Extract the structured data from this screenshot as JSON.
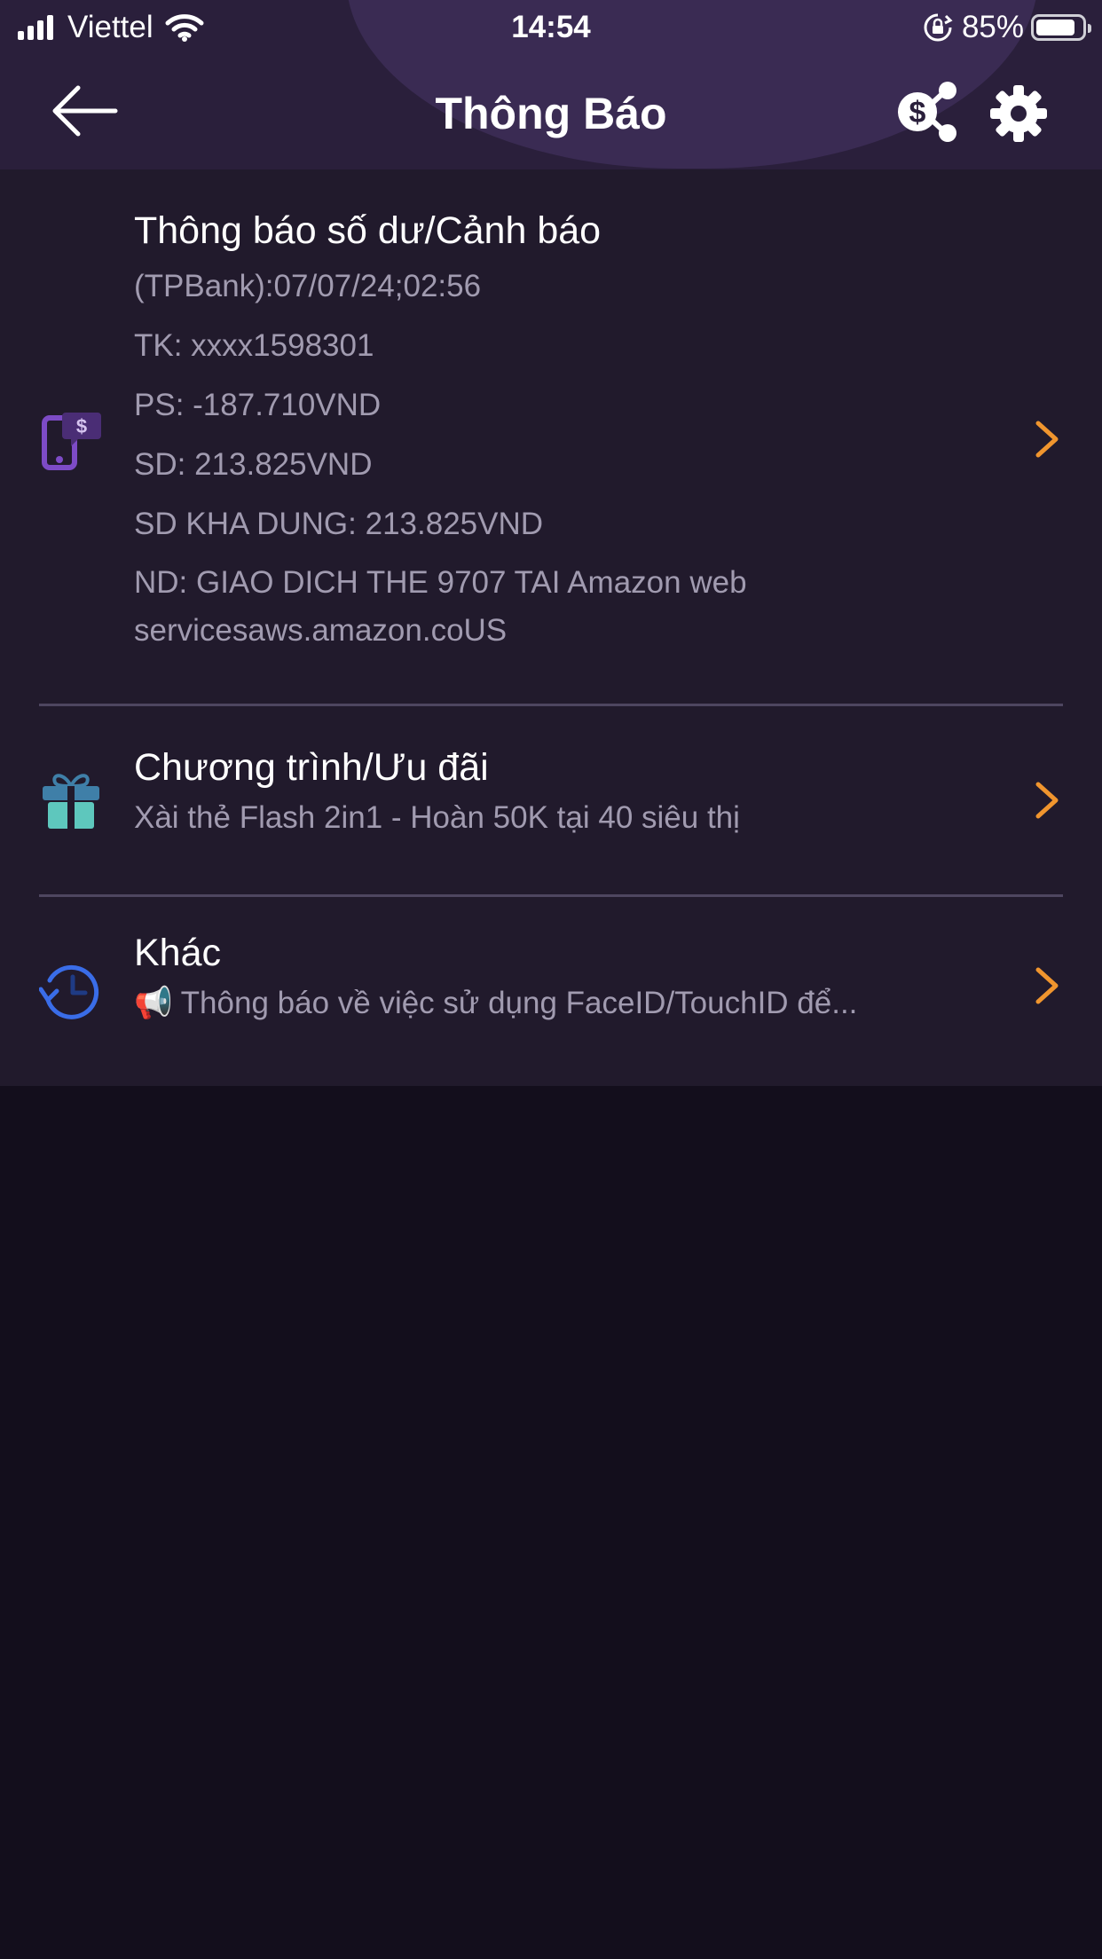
{
  "status_bar": {
    "carrier": "Viettel",
    "time": "14:54",
    "battery_percent": "85%",
    "battery_level": 0.85
  },
  "nav": {
    "title": "Thông Báo",
    "back_icon": "back-arrow-icon",
    "share_icon": "money-share-icon",
    "settings_icon": "gear-icon"
  },
  "items": [
    {
      "title": "Thông báo số dư/Cảnh báo",
      "icon": "phone-dollar-icon",
      "lines": [
        "(TPBank):07/07/24;02:56",
        "TK: xxxx1598301",
        "PS: -187.710VND",
        "SD: 213.825VND",
        "SD KHA DUNG: 213.825VND",
        "ND: GIAO DICH THE 9707 TAI Amazon web servicesaws.amazon.coUS"
      ]
    },
    {
      "title": "Chương trình/Ưu đãi",
      "icon": "gift-icon",
      "subtitle": "Xài thẻ Flash 2in1 - Hoàn 50K tại 40 siêu thị"
    },
    {
      "title": "Khác",
      "icon": "history-clock-icon",
      "subtitle": "📢 Thông báo về việc sử dụng FaceID/TouchID để..."
    }
  ],
  "colors": {
    "header_bg": "#2a1f3b",
    "list_bg": "#211a2c",
    "page_bg": "#130e1c",
    "chevron": "#f0952e",
    "secondary_text": "#a19bb0",
    "accent_purple": "#7d4bc6",
    "accent_teal": "#5ec7bd",
    "accent_blue": "#3a6de8"
  }
}
